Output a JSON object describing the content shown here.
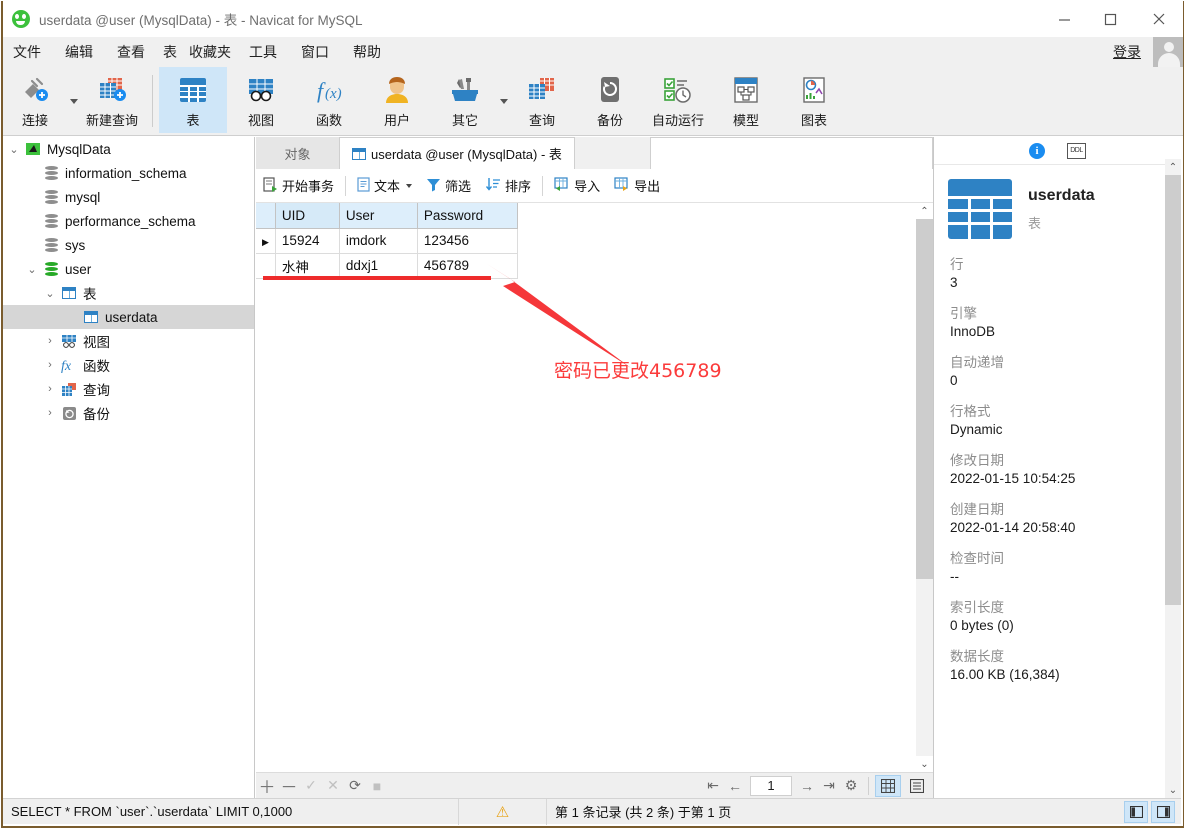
{
  "window": {
    "title": "userdata @user (MysqlData) - 表 - Navicat for MySQL",
    "app_icon": "navicat-icon",
    "minimize": "minimize-icon",
    "maximize": "maximize-icon",
    "close": "close-icon"
  },
  "menubar": {
    "items": [
      {
        "label": "文件"
      },
      {
        "label": "编辑"
      },
      {
        "label": "查看"
      },
      {
        "label": "表"
      },
      {
        "label": "收藏夹"
      },
      {
        "label": "工具"
      },
      {
        "label": "窗口"
      },
      {
        "label": "帮助"
      }
    ],
    "login_label": "登录"
  },
  "toolbar": {
    "items": [
      {
        "label": "连接",
        "icon": "connection-icon",
        "dropdown": true,
        "selected": false
      },
      {
        "label": "新建查询",
        "icon": "new-query-icon",
        "dropdown": false,
        "selected": false
      },
      {
        "label": "表",
        "icon": "table-icon",
        "dropdown": false,
        "selected": true
      },
      {
        "label": "视图",
        "icon": "view-icon",
        "dropdown": false,
        "selected": false
      },
      {
        "label": "函数",
        "icon": "function-icon",
        "dropdown": false,
        "selected": false
      },
      {
        "label": "用户",
        "icon": "user-icon",
        "dropdown": false,
        "selected": false
      },
      {
        "label": "其它",
        "icon": "other-tools-icon",
        "dropdown": true,
        "selected": false
      },
      {
        "label": "查询",
        "icon": "query-icon",
        "dropdown": false,
        "selected": false
      },
      {
        "label": "备份",
        "icon": "backup-icon",
        "dropdown": false,
        "selected": false
      },
      {
        "label": "自动运行",
        "icon": "automation-icon",
        "dropdown": false,
        "selected": false
      },
      {
        "label": "模型",
        "icon": "model-icon",
        "dropdown": false,
        "selected": false
      },
      {
        "label": "图表",
        "icon": "chart-icon",
        "dropdown": false,
        "selected": false
      }
    ]
  },
  "tree": {
    "nodes": [
      {
        "label": "MysqlData",
        "icon": "connection-node-icon",
        "indent": 0,
        "twisty": "open",
        "selected": false
      },
      {
        "label": "information_schema",
        "icon": "database-icon",
        "indent": 1,
        "twisty": "none",
        "selected": false
      },
      {
        "label": "mysql",
        "icon": "database-icon",
        "indent": 1,
        "twisty": "none",
        "selected": false
      },
      {
        "label": "performance_schema",
        "icon": "database-icon",
        "indent": 1,
        "twisty": "none",
        "selected": false
      },
      {
        "label": "sys",
        "icon": "database-icon",
        "indent": 1,
        "twisty": "none",
        "selected": false
      },
      {
        "label": "user",
        "icon": "database-open-icon",
        "indent": 1,
        "twisty": "open",
        "selected": false
      },
      {
        "label": "表",
        "icon": "tables-folder-icon",
        "indent": 2,
        "twisty": "open",
        "selected": false
      },
      {
        "label": "userdata",
        "icon": "table-node-icon",
        "indent": 3,
        "twisty": "none",
        "selected": true
      },
      {
        "label": "视图",
        "icon": "views-folder-icon",
        "indent": 2,
        "twisty": "closed",
        "selected": false
      },
      {
        "label": "函数",
        "icon": "functions-folder-icon",
        "indent": 2,
        "twisty": "closed",
        "selected": false
      },
      {
        "label": "查询",
        "icon": "queries-folder-icon",
        "indent": 2,
        "twisty": "closed",
        "selected": false
      },
      {
        "label": "备份",
        "icon": "backups-folder-icon",
        "indent": 2,
        "twisty": "closed",
        "selected": false
      }
    ]
  },
  "tabs": {
    "object_tab": "对象",
    "active_tab": "userdata @user (MysqlData) - 表"
  },
  "gridbar": {
    "items": [
      {
        "label": "开始事务",
        "icon": "begin-transaction-icon",
        "dropdown": false
      },
      {
        "label": "文本",
        "icon": "text-icon",
        "dropdown": true
      },
      {
        "label": "筛选",
        "icon": "filter-icon",
        "dropdown": false
      },
      {
        "label": "排序",
        "icon": "sort-icon",
        "dropdown": false
      },
      {
        "label": "导入",
        "icon": "import-icon",
        "dropdown": false
      },
      {
        "label": "导出",
        "icon": "export-icon",
        "dropdown": false
      }
    ]
  },
  "grid": {
    "columns": [
      "UID",
      "User",
      "Password"
    ],
    "rows": [
      {
        "current": true,
        "cells": [
          "15924",
          "imdork",
          "123456"
        ]
      },
      {
        "current": false,
        "cells": [
          "水神",
          "ddxj1",
          "456789"
        ]
      }
    ]
  },
  "pagination": {
    "add": "add-row-icon",
    "remove": "delete-row-icon",
    "apply": "apply-change-icon",
    "cancel": "cancel-change-icon",
    "refresh": "refresh-icon",
    "stop": "stop-icon",
    "first": "first-page-icon",
    "prev": "prev-page-icon",
    "page_value": "1",
    "next": "next-page-icon",
    "last": "last-page-icon",
    "settings": "gear-icon",
    "grid_view": "grid-view-icon",
    "form_view": "form-view-icon"
  },
  "info_panel": {
    "info_icon": "info-icon",
    "ddl_icon": "ddl-icon",
    "object_name": "userdata",
    "object_type": "表",
    "properties": [
      {
        "key": "行",
        "value": "3"
      },
      {
        "key": "引擎",
        "value": "InnoDB"
      },
      {
        "key": "自动递增",
        "value": "0"
      },
      {
        "key": "行格式",
        "value": "Dynamic"
      },
      {
        "key": "修改日期",
        "value": "2022-01-15 10:54:25"
      },
      {
        "key": "创建日期",
        "value": "2022-01-14 20:58:40"
      },
      {
        "key": "检查时间",
        "value": "--"
      },
      {
        "key": "索引长度",
        "value": "0 bytes (0)"
      },
      {
        "key": "数据长度",
        "value": "16.00 KB (16,384)"
      }
    ]
  },
  "statusbar": {
    "sql": "SELECT * FROM `user`.`userdata` LIMIT 0,1000",
    "warning_icon": "warning-icon",
    "record_info": "第 1 条记录 (共 2 条) 于第 1 页",
    "left_panel_toggle": "toggle-left-panel-icon",
    "right_panel_toggle": "toggle-right-panel-icon"
  },
  "annotation": {
    "text": "密码已更改456789",
    "color": "#fb3b3b",
    "underline_color": "#ee2b2b",
    "arrow": "annotation-arrow"
  }
}
